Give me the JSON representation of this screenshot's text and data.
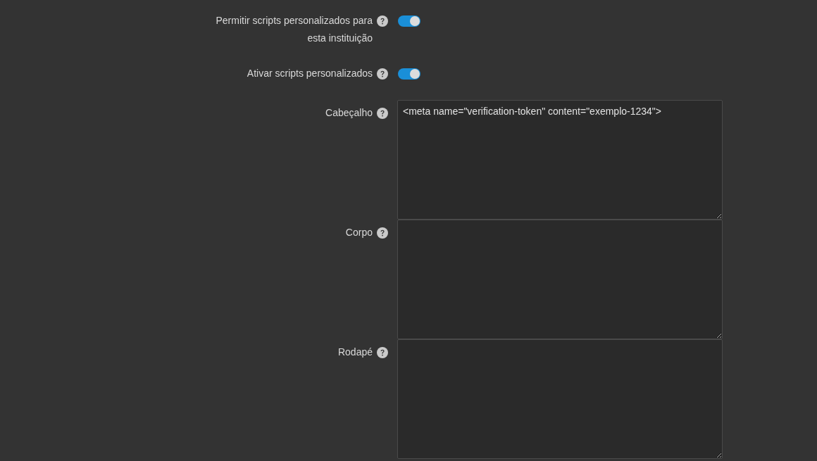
{
  "settings": [
    {
      "kind": "toggle",
      "label": "Permitir scripts personalizados para esta instituição",
      "on": true
    },
    {
      "kind": "toggle",
      "label": "Ativar scripts personalizados",
      "on": true
    },
    {
      "kind": "textarea",
      "label": "Cabeçalho",
      "value": "<meta name=\"verification-token\" content=\"exemplo-1234\">"
    },
    {
      "kind": "textarea",
      "label": "Corpo"
    },
    {
      "kind": "textarea",
      "label": "Rodapé"
    }
  ]
}
